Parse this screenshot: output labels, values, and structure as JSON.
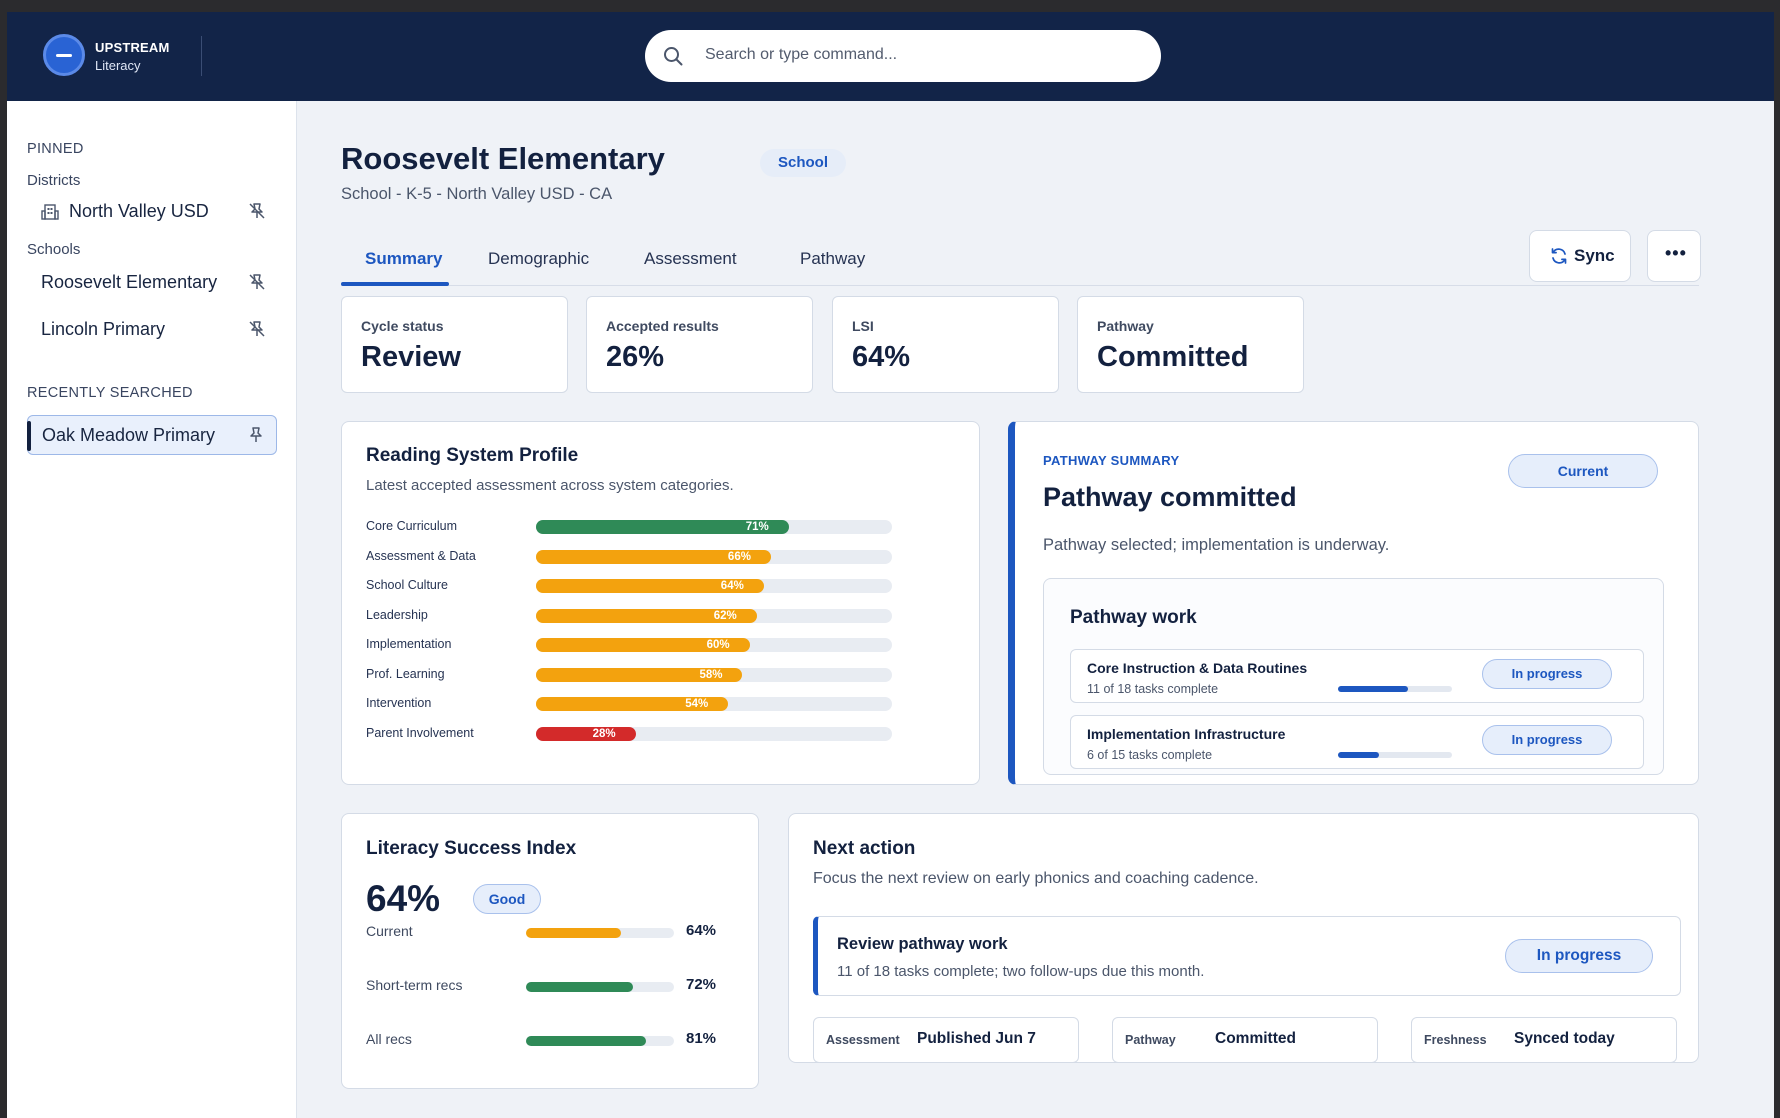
{
  "brand": {
    "name": "UPSTREAM",
    "product": "Literacy"
  },
  "search": {
    "placeholder": "Search or type command..."
  },
  "sidebar": {
    "pinned_heading": "PINNED",
    "districts_heading": "Districts",
    "districts": [
      {
        "label": "North Valley USD"
      }
    ],
    "schools_heading": "Schools",
    "schools": [
      {
        "label": "Roosevelt Elementary"
      },
      {
        "label": "Lincoln Primary"
      }
    ],
    "recent_heading": "RECENTLY SEARCHED",
    "recent": [
      {
        "label": "Oak Meadow Primary"
      }
    ]
  },
  "page": {
    "title": "Roosevelt Elementary",
    "type_badge": "School",
    "subtitle": "School - K-5 - North Valley USD - CA"
  },
  "tabs": [
    {
      "label": "Summary",
      "active": true
    },
    {
      "label": "Demographic"
    },
    {
      "label": "Assessment"
    },
    {
      "label": "Pathway"
    }
  ],
  "actions": {
    "sync_label": "Sync",
    "more_label": "•••"
  },
  "stats": [
    {
      "label": "Cycle status",
      "value": "Review"
    },
    {
      "label": "Accepted results",
      "value": "26%"
    },
    {
      "label": "LSI",
      "value": "64%"
    },
    {
      "label": "Pathway",
      "value": "Committed"
    }
  ],
  "reading_profile": {
    "title": "Reading System Profile",
    "subtitle": "Latest accepted assessment across system categories.",
    "rows": [
      {
        "label": "Core Curriculum",
        "value": 71,
        "display": "71%",
        "color": "#2f8a57"
      },
      {
        "label": "Assessment & Data",
        "value": 66,
        "display": "66%",
        "color": "#f3a20e"
      },
      {
        "label": "School Culture",
        "value": 64,
        "display": "64%",
        "color": "#f3a20e"
      },
      {
        "label": "Leadership",
        "value": 62,
        "display": "62%",
        "color": "#f3a20e"
      },
      {
        "label": "Implementation",
        "value": 60,
        "display": "60%",
        "color": "#f3a20e"
      },
      {
        "label": "Prof. Learning",
        "value": 58,
        "display": "58%",
        "color": "#f3a20e"
      },
      {
        "label": "Intervention",
        "value": 54,
        "display": "54%",
        "color": "#f3a20e"
      },
      {
        "label": "Parent Involvement",
        "value": 28,
        "display": "28%",
        "color": "#d32a2a"
      }
    ]
  },
  "pathway_summary": {
    "kicker": "PATHWAY SUMMARY",
    "status": "Current",
    "title": "Pathway committed",
    "description": "Pathway selected; implementation is underway.",
    "work_title": "Pathway work",
    "work_items": [
      {
        "title": "Core Instruction & Data Routines",
        "sub": "11 of 18 tasks complete",
        "progress": 0.61,
        "status": "In progress"
      },
      {
        "title": "Implementation Infrastructure",
        "sub": "6 of 15 tasks complete",
        "progress": 0.36,
        "status": "In progress"
      }
    ]
  },
  "lsi": {
    "title": "Literacy Success Index",
    "value": "64%",
    "badge": "Good",
    "rows": [
      {
        "label": "Current",
        "value": 64,
        "display": "64%",
        "color": "#f3a20e"
      },
      {
        "label": "Short-term recs",
        "value": 72,
        "display": "72%",
        "color": "#2f8a57"
      },
      {
        "label": "All recs",
        "value": 81,
        "display": "81%",
        "color": "#2f8a57"
      }
    ]
  },
  "next_action": {
    "title": "Next action",
    "subtitle": "Focus the next review on early phonics and coaching cadence.",
    "review_title": "Review pathway work",
    "review_sub": "11 of 18 tasks complete; two follow-ups due this month.",
    "review_status": "In progress",
    "meta": [
      {
        "key": "Assessment",
        "value": "Published Jun 7"
      },
      {
        "key": "Pathway",
        "value": "Committed"
      },
      {
        "key": "Freshness",
        "value": "Synced today"
      }
    ]
  },
  "colors": {
    "navy": "#122448",
    "accent": "#1d57c0",
    "green": "#2f8a57",
    "amber": "#f3a20e",
    "red": "#d32a2a"
  }
}
